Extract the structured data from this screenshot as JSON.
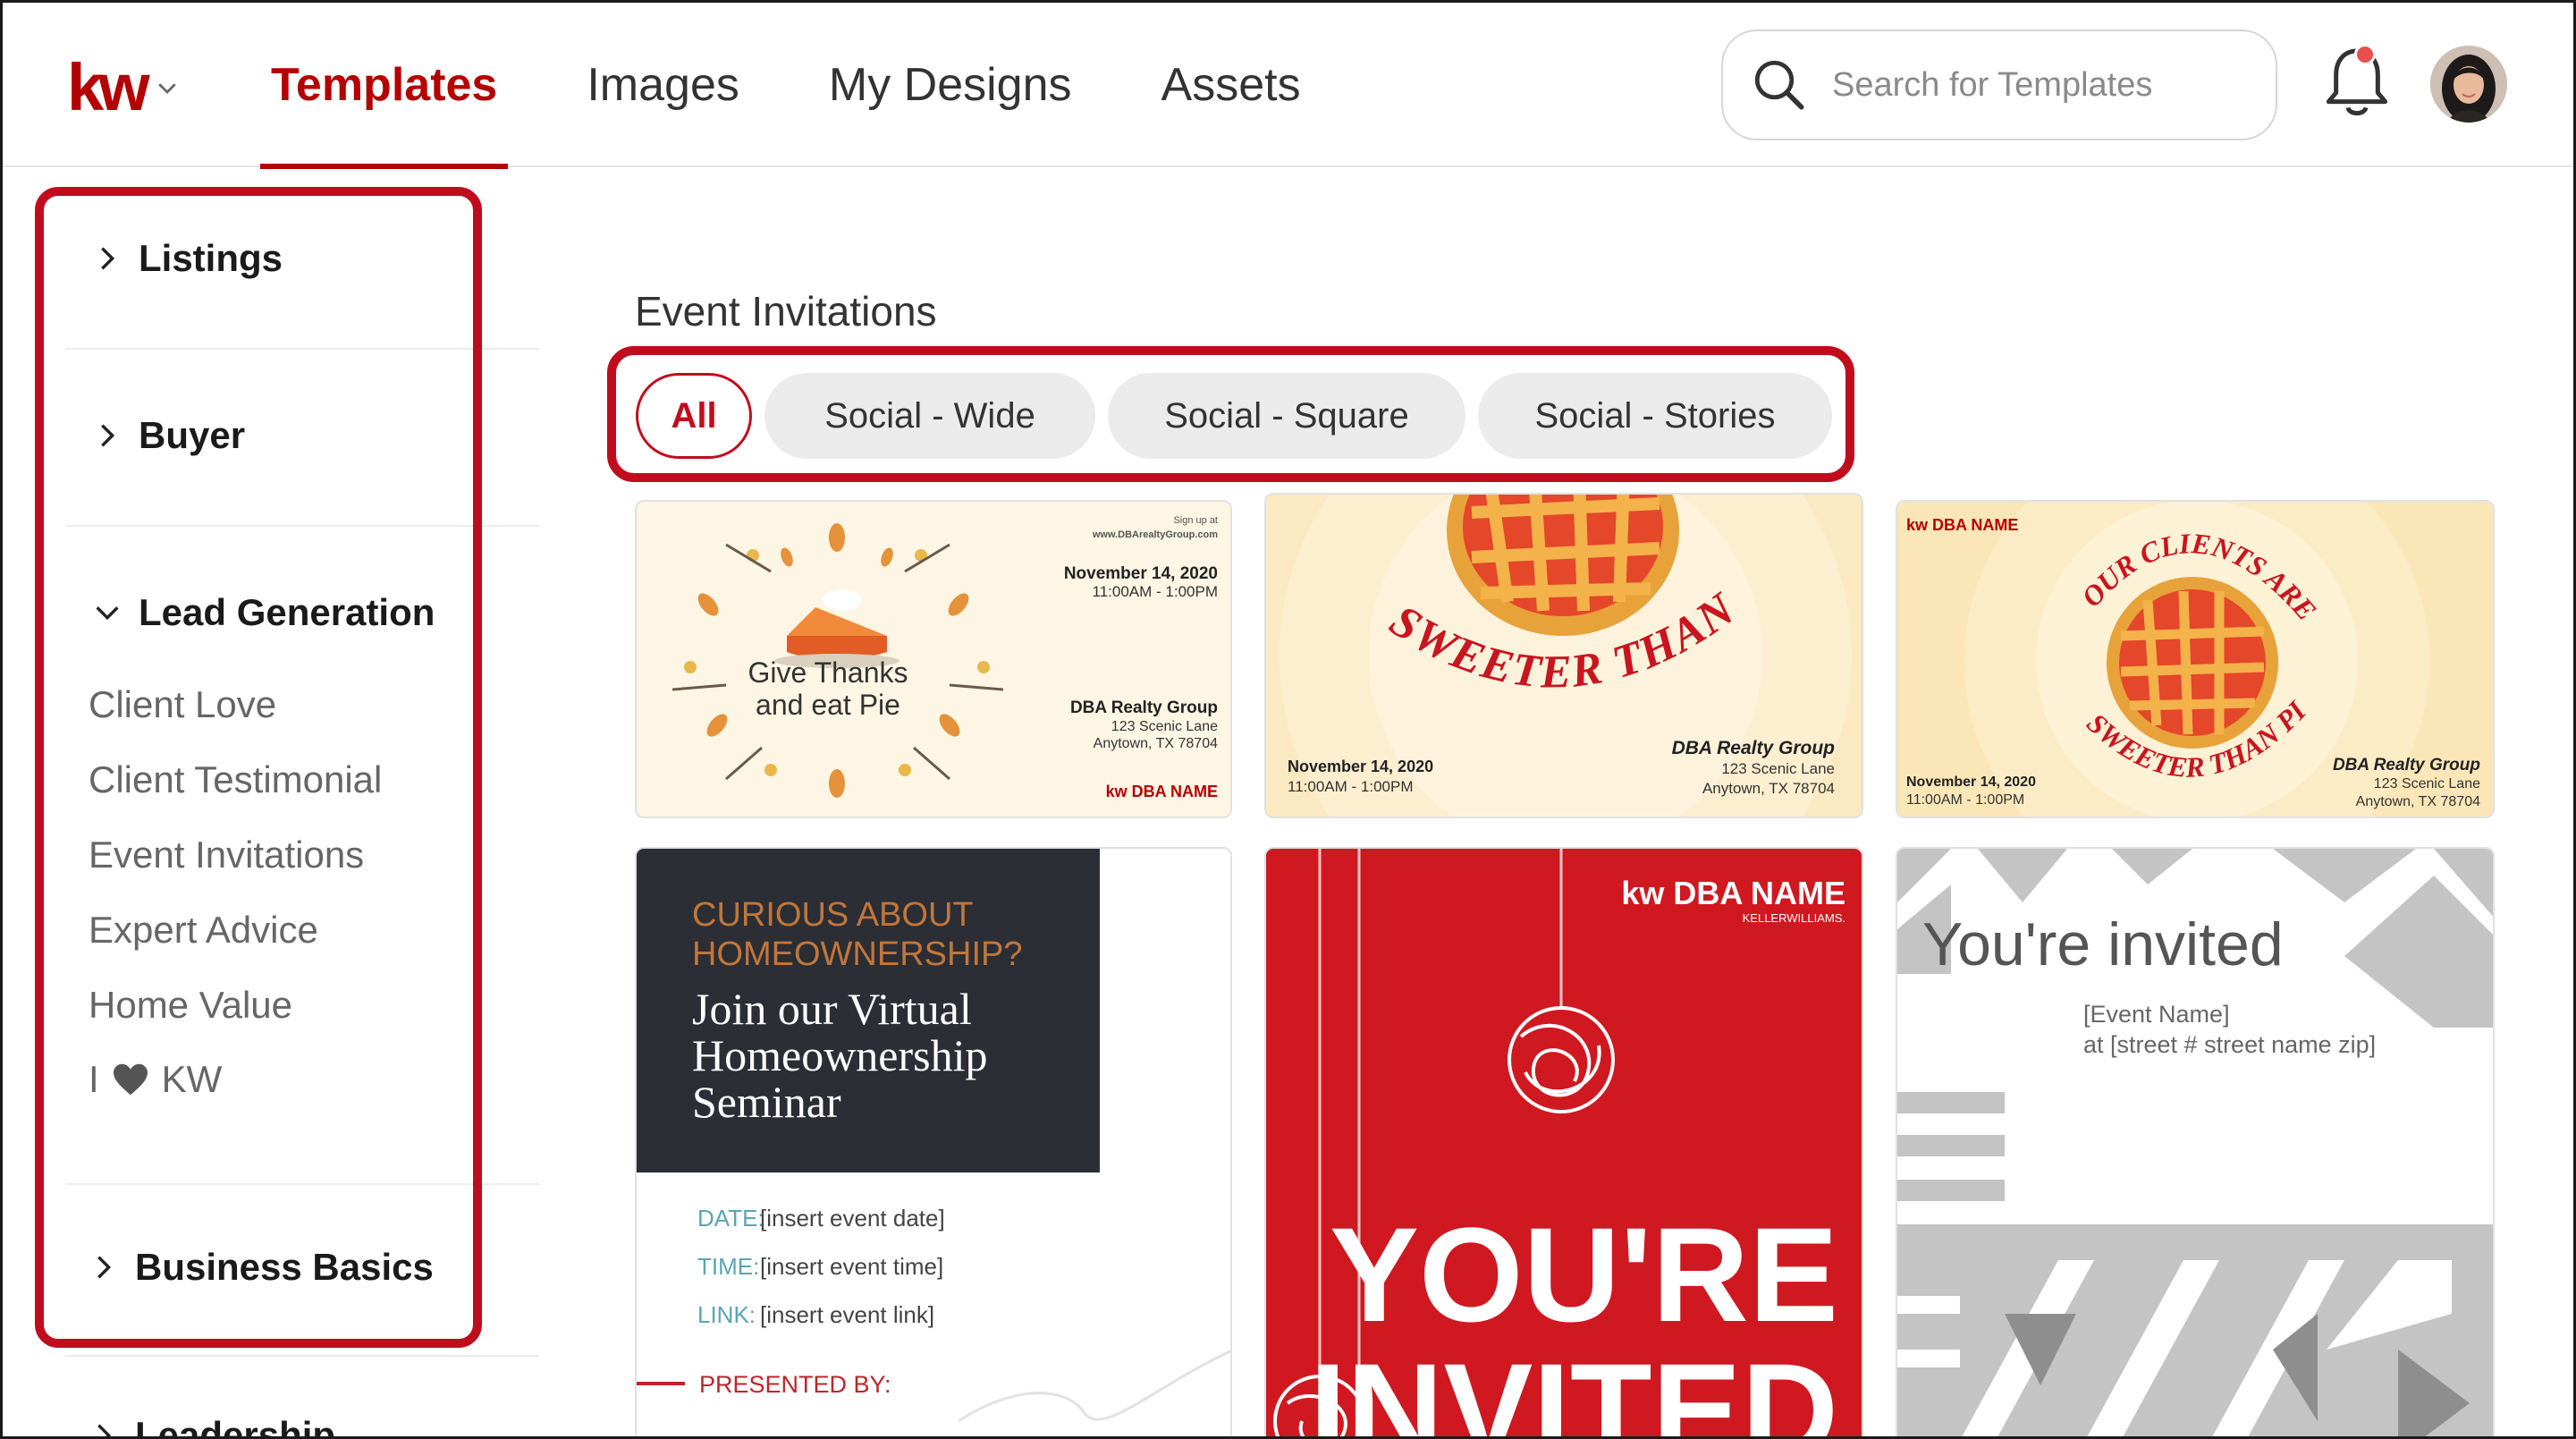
{
  "header": {
    "logo_text": "kw",
    "nav_tabs": [
      {
        "label": "Templates",
        "active": true
      },
      {
        "label": "Images",
        "active": false
      },
      {
        "label": "My Designs",
        "active": false
      },
      {
        "label": "Assets",
        "active": false
      }
    ],
    "search_placeholder": "Search for Templates",
    "icons": {
      "search": "search-icon",
      "notifications": "bell-icon",
      "logo_menu": "chevron-down-icon"
    }
  },
  "sidebar": {
    "categories": {
      "listings": "Listings",
      "buyer": "Buyer",
      "lead_generation": "Lead Generation",
      "business_basics": "Business Basics",
      "leadership": "Leadership"
    },
    "lead_generation_items": [
      "Client Love",
      "Client Testimonial",
      "Event Invitations",
      "Expert Advice",
      "Home Value"
    ],
    "i_love_kw": {
      "prefix": "I",
      "suffix": "KW"
    }
  },
  "main": {
    "section_title": "Event Invitations",
    "filters": [
      "All",
      "Social - Wide",
      "Social - Square",
      "Social - Stories"
    ],
    "active_filter": "All",
    "cards": {
      "pie1": {
        "signup": "Sign up at",
        "url": "www.DBArealtyGroup.com",
        "date": "November 14, 2020",
        "time": "11:00AM - 1:00PM",
        "line1": "Give Thanks",
        "line2": "and eat Pie",
        "group": "DBA Realty Group",
        "addr1": "123 Scenic Lane",
        "addr2": "Anytown, TX 78704",
        "logo": "kw DBA NAME"
      },
      "pie2": {
        "headline": "SWEETER THAN PIE",
        "date": "November 14, 2020",
        "time": "11:00AM - 1:00PM",
        "group": "DBA Realty Group",
        "addr1": "123 Scenic Lane",
        "addr2": "Anytown, TX 78704"
      },
      "pie3": {
        "logo": "kw DBA NAME",
        "arc_top": "OUR CLIENTS ARE",
        "arc_bottom": "SWEETER THAN PIE",
        "date": "November 14, 2020",
        "time": "11:00AM - 1:00PM",
        "group": "DBA Realty Group",
        "addr1": "123 Scenic Lane",
        "addr2": "Anytown, TX 78704"
      },
      "seminar": {
        "kicker1": "CURIOUS ABOUT",
        "kicker2": "HOMEOWNERSHIP?",
        "title1": "Join our Virtual",
        "title2": "Homeownership",
        "title3": "Seminar",
        "date_label": "DATE:",
        "date_value": "[insert event date]",
        "time_label": "TIME:",
        "time_value": "[insert event time]",
        "link_label": "LINK:",
        "link_value": "[insert event link]",
        "presented": "PRESENTED BY:"
      },
      "red": {
        "logo": "kw DBA NAME",
        "sub": "KELLERWILLIAMS.",
        "line1": "YOU'RE",
        "line2": "INVITED"
      },
      "gray": {
        "title": "You're invited",
        "line1": "[Event Name]",
        "line2": "at [street # street name zip]"
      }
    }
  },
  "colors": {
    "brand_red": "#b40101",
    "highlight_red": "#c00d1e",
    "invite_red": "#d01820",
    "seminar_dark": "#2b2e35",
    "seminar_accent": "#c2763b",
    "seminar_teal": "#5aa5b3"
  }
}
